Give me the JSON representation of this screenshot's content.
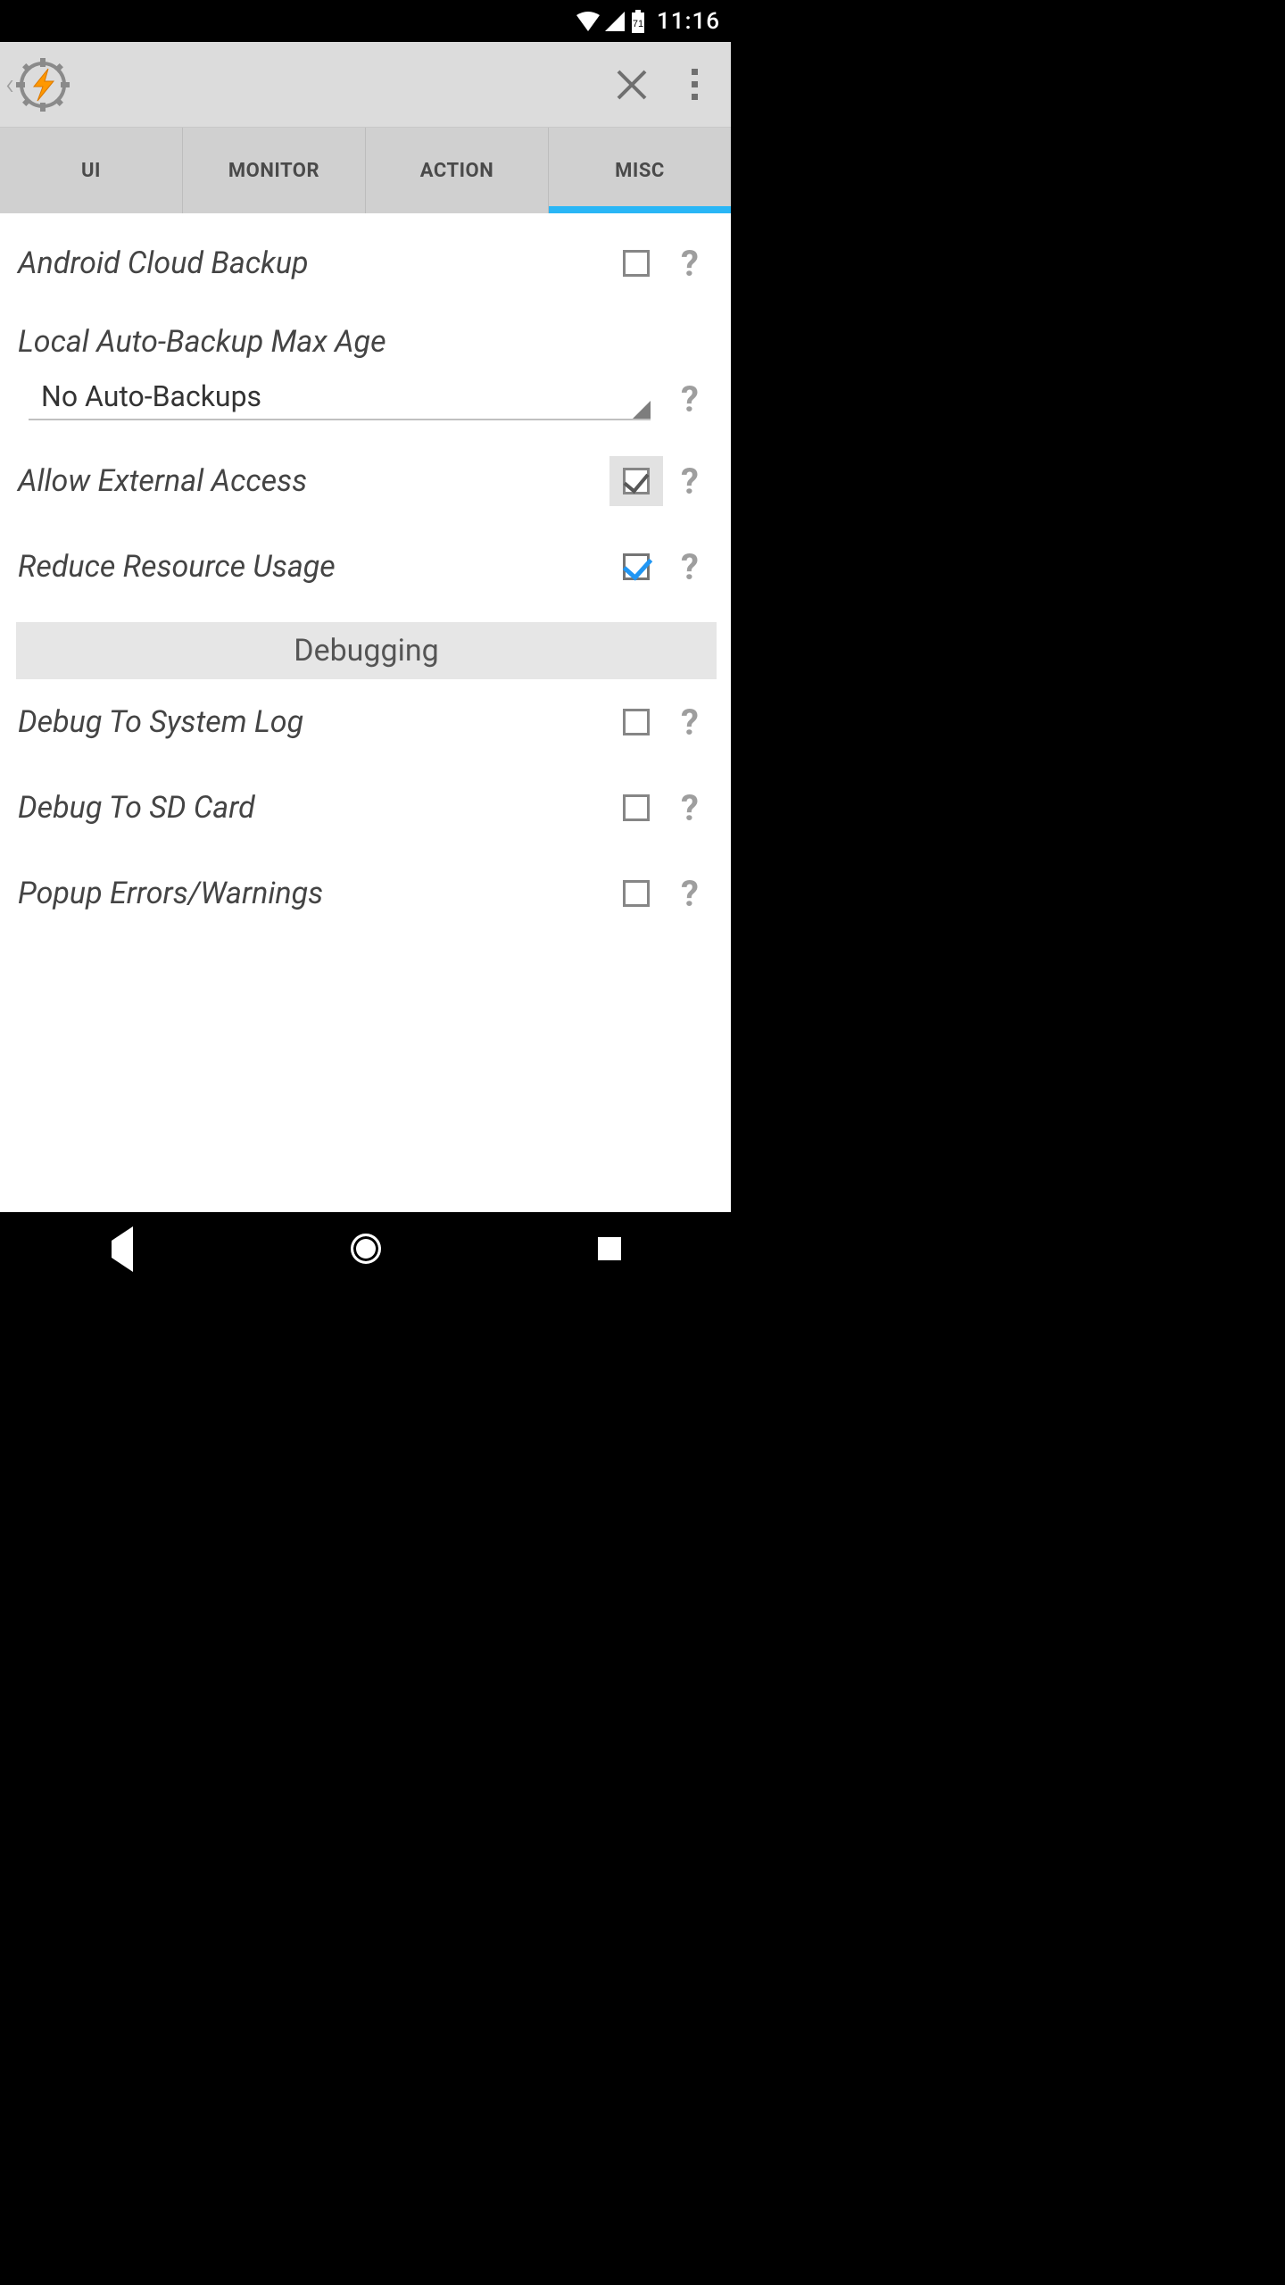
{
  "status": {
    "time": "11:16",
    "battery": "71"
  },
  "tabs": [
    {
      "id": "ui",
      "label": "UI"
    },
    {
      "id": "monitor",
      "label": "MONITOR"
    },
    {
      "id": "action",
      "label": "ACTION"
    },
    {
      "id": "misc",
      "label": "MISC",
      "active": true
    }
  ],
  "settings": {
    "backup_cloud": {
      "label": "Android Cloud Backup",
      "checked": false
    },
    "backup_age": {
      "label": "Local Auto-Backup Max Age",
      "value": "No Auto-Backups"
    },
    "external_access": {
      "label": "Allow External Access",
      "checked": true,
      "style": "dark-boxed"
    },
    "reduce_resource": {
      "label": "Reduce Resource Usage",
      "checked": true,
      "style": "blue"
    },
    "section_debug": {
      "label": "Debugging"
    },
    "debug_syslog": {
      "label": "Debug To System Log",
      "checked": false
    },
    "debug_sdcard": {
      "label": "Debug To SD Card",
      "checked": false
    },
    "popup_errors": {
      "label": "Popup Errors/Warnings",
      "checked": false
    }
  },
  "colors": {
    "accent": "#29b6f6"
  }
}
